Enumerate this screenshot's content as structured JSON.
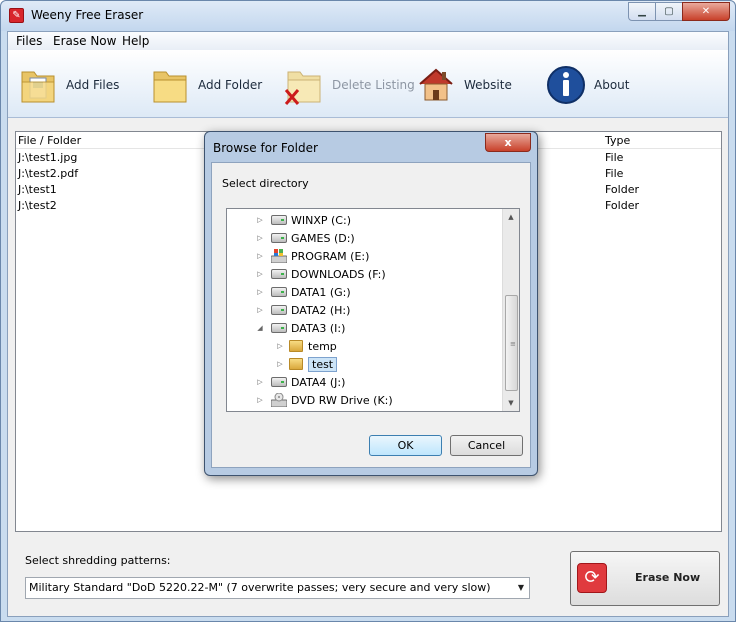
{
  "window": {
    "title": "Weeny Free Eraser"
  },
  "menu": [
    "Files",
    "Erase Now",
    "Help"
  ],
  "toolbar": {
    "add_files": "Add Files",
    "add_folder": "Add Folder",
    "delete_listing": "Delete Listing",
    "website": "Website",
    "about": "About"
  },
  "file_list": {
    "columns": [
      "File / Folder",
      "Type"
    ],
    "rows": [
      {
        "name": "J:\\test1.jpg",
        "type": "File"
      },
      {
        "name": "J:\\test2.pdf",
        "type": "File"
      },
      {
        "name": "J:\\test1",
        "type": "Folder"
      },
      {
        "name": "J:\\test2",
        "type": "Folder"
      }
    ]
  },
  "shred": {
    "label": "Select shredding patterns:",
    "selected": "Military Standard \"DoD 5220.22-M\" (7 overwrite passes; very secure and very slow)"
  },
  "erase_button": "Erase Now",
  "dialog": {
    "title": "Browse for Folder",
    "close": "x",
    "prompt": "Select directory",
    "tree": [
      {
        "label": "WINXP (C:)",
        "icon": "drive-icon"
      },
      {
        "label": "GAMES (D:)",
        "icon": "drive-icon"
      },
      {
        "label": "PROGRAM (E:)",
        "icon": "windows-drive-icon"
      },
      {
        "label": "DOWNLOADS (F:)",
        "icon": "drive-icon"
      },
      {
        "label": "DATA1 (G:)",
        "icon": "drive-icon"
      },
      {
        "label": "DATA2 (H:)",
        "icon": "drive-icon"
      },
      {
        "label": "DATA3 (I:)",
        "icon": "drive-icon"
      },
      {
        "label": "temp",
        "icon": "folder-icon"
      },
      {
        "label": "test",
        "icon": "folder-icon"
      },
      {
        "label": "DATA4 (J:)",
        "icon": "drive-icon"
      },
      {
        "label": "DVD RW Drive (K:)",
        "icon": "dvd-drive-icon"
      }
    ],
    "ok": "OK",
    "cancel": "Cancel"
  }
}
